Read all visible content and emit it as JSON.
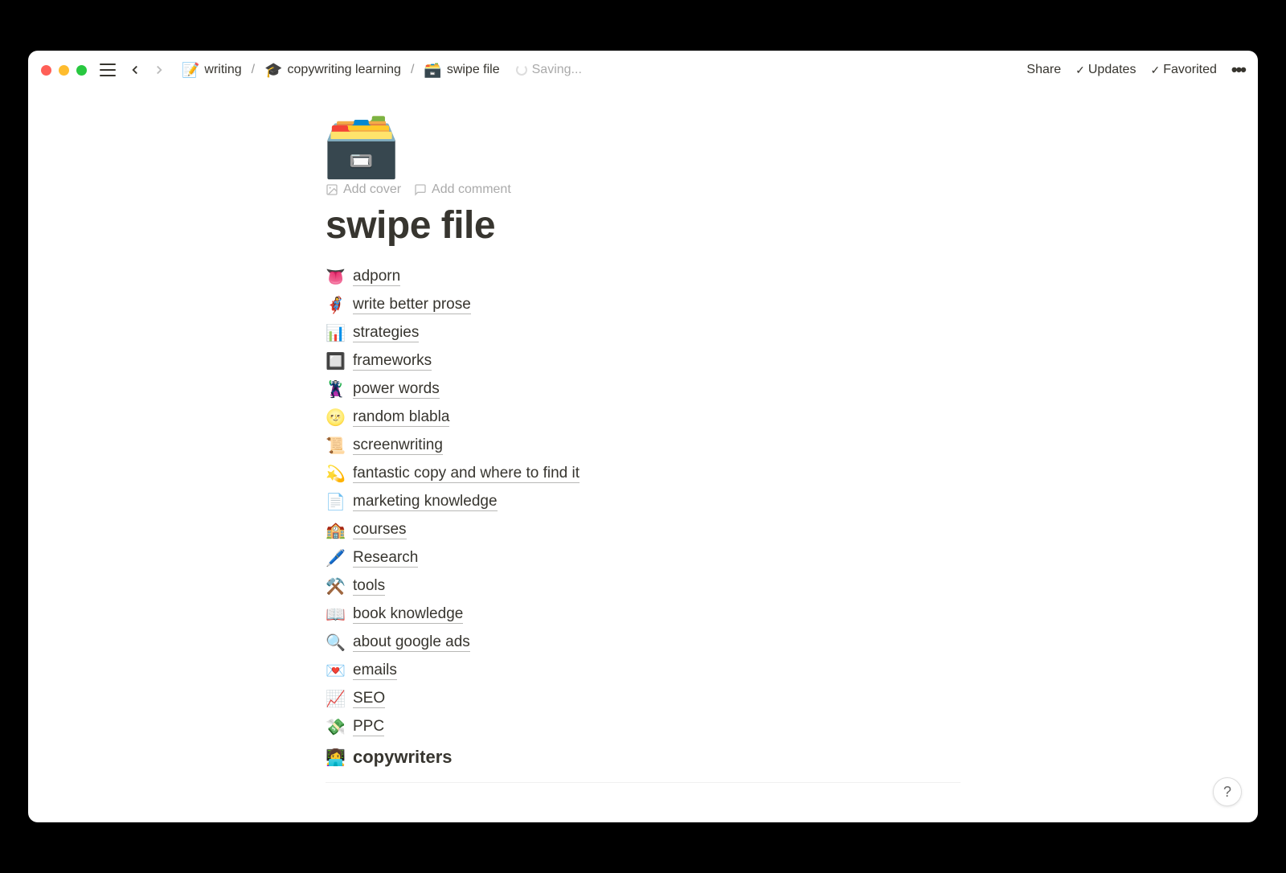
{
  "breadcrumbs": [
    {
      "icon": "📝",
      "label": "writing"
    },
    {
      "icon": "🎓",
      "label": "copywriting learning"
    },
    {
      "icon": "🗃️",
      "label": "swipe file"
    }
  ],
  "saving_label": "Saving...",
  "topbar": {
    "share": "Share",
    "updates": "Updates",
    "favorited": "Favorited"
  },
  "page": {
    "icon": "🗃️",
    "add_cover": "Add cover",
    "add_comment": "Add comment",
    "title": "swipe file"
  },
  "links": [
    {
      "icon": "👅",
      "label": "adporn"
    },
    {
      "icon": "🦸‍♀️",
      "label": "write better prose"
    },
    {
      "icon": "📊",
      "label": "strategies"
    },
    {
      "icon": "🔲",
      "label": "frameworks"
    },
    {
      "icon": "🦹",
      "label": "power words"
    },
    {
      "icon": "🌝",
      "label": "random blabla"
    },
    {
      "icon": "📜",
      "label": "screenwriting"
    },
    {
      "icon": "💫",
      "label": "fantastic copy and where to find it"
    },
    {
      "icon": "📄",
      "label": "marketing knowledge"
    },
    {
      "icon": "🏫",
      "label": "courses"
    },
    {
      "icon": "🖊️",
      "label": "Research"
    },
    {
      "icon": "⚒️",
      "label": "tools"
    },
    {
      "icon": "📖",
      "label": "book knowledge"
    },
    {
      "icon": "🔍",
      "label": "about google ads"
    },
    {
      "icon": "💌",
      "label": "emails"
    },
    {
      "icon": "📈",
      "label": "SEO"
    },
    {
      "icon": "💸",
      "label": "PPC"
    }
  ],
  "toggle": {
    "icon": "👩‍💻",
    "label": "copywriters"
  },
  "help": "?"
}
